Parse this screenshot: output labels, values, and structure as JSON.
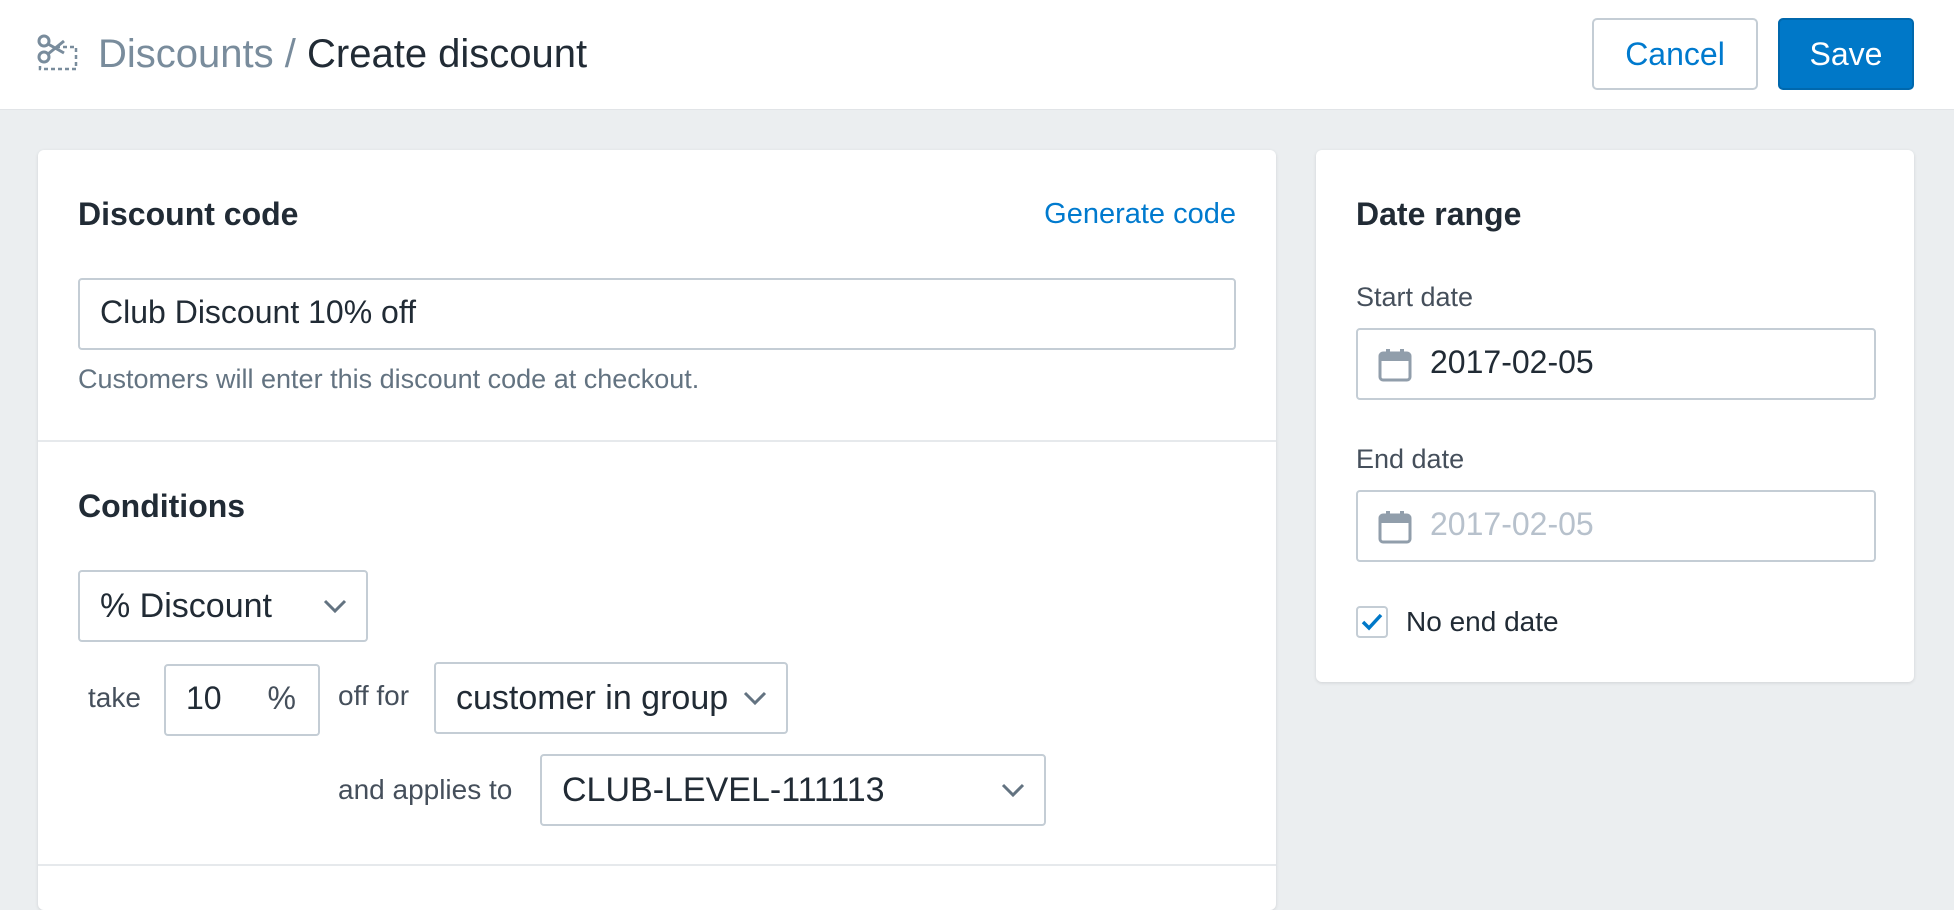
{
  "header": {
    "breadcrumb_parent": "Discounts",
    "breadcrumb_separator": "/",
    "title": "Create discount",
    "icon": "scissors-icon",
    "cancel_label": "Cancel",
    "save_label": "Save"
  },
  "discount_code": {
    "heading": "Discount code",
    "generate_link": "Generate code",
    "value": "Club Discount 10% off",
    "help_text": "Customers will enter this discount code at checkout."
  },
  "conditions": {
    "heading": "Conditions",
    "discount_type": "% Discount",
    "take_label": "take",
    "amount": "10",
    "unit": "%",
    "off_for_label": "off for",
    "audience": "customer in group",
    "applies_to_label": "and applies to",
    "group": "CLUB-LEVEL-111113"
  },
  "date_range": {
    "heading": "Date range",
    "start_label": "Start date",
    "start_value": "2017-02-05",
    "end_label": "End date",
    "end_placeholder": "2017-02-05",
    "no_end_label": "No end date",
    "no_end_checked": true,
    "icon": "calendar-icon"
  },
  "colors": {
    "accent": "#0078c8",
    "link": "#007ace",
    "background": "#ebeef0"
  }
}
